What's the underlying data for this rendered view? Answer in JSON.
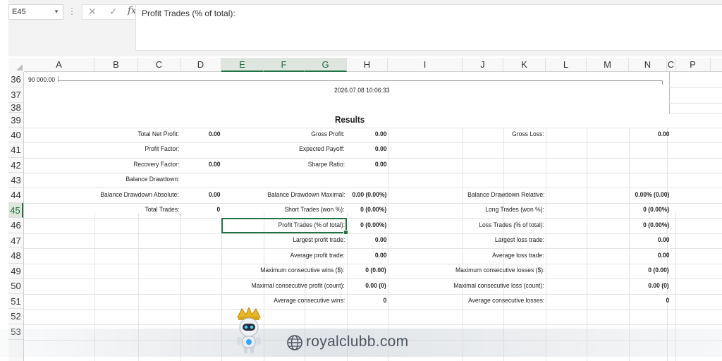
{
  "formula_bar": {
    "name_box": "E45",
    "formula": "Profit Trades (% of total):"
  },
  "columns": [
    "A",
    "B",
    "C",
    "D",
    "E",
    "F",
    "G",
    "H",
    "I",
    "J",
    "K",
    "L",
    "M",
    "N",
    "C",
    "P"
  ],
  "selected_column_letters": [
    "E",
    "F",
    "G"
  ],
  "rows": [
    "36",
    "37",
    "38",
    "39",
    "40",
    "41",
    "42",
    "43",
    "44",
    "45",
    "46",
    "47",
    "48",
    "49",
    "50",
    "51",
    "52",
    "53"
  ],
  "selected_row": "45",
  "chart": {
    "axis_label": "90 000.00"
  },
  "report": {
    "timestamp": "2026.07.08 10:06:33",
    "heading": "Results",
    "left": [
      {
        "label": "Total Net Profit:",
        "value": "0.00"
      },
      {
        "label": "Profit Factor:",
        "value": ""
      },
      {
        "label": "Recovery Factor:",
        "value": "0.00"
      },
      {
        "label": "Balance Drawdown:",
        "value": ""
      },
      {
        "label": "Balance Drawdown Absolute:",
        "value": "0.00"
      },
      {
        "label": "Total Trades:",
        "value": "0"
      }
    ],
    "middle": [
      {
        "label": "Gross Profit:",
        "value": "0.00"
      },
      {
        "label": "Expected Payoff:",
        "value": "0.00"
      },
      {
        "label": "Sharpe Ratio:",
        "value": "0.00"
      },
      {
        "label": "",
        "value": ""
      },
      {
        "label": "Balance Drawdown Maximal:",
        "value": "0.00 (0.00%)"
      },
      {
        "label": "Short Trades (won %):",
        "value": "0 (0.00%)"
      },
      {
        "label": "Profit Trades (% of total):",
        "value": "0 (0.00%)"
      },
      {
        "label": "Largest profit trade:",
        "value": "0.00"
      },
      {
        "label": "Average profit trade:",
        "value": "0.00"
      },
      {
        "label": "Maximum consecutive wins ($):",
        "value": "0 (0.00)"
      },
      {
        "label": "Maximal consecutive profit (count):",
        "value": "0.00 (0)"
      },
      {
        "label": "Average consecutive wins:",
        "value": "0"
      }
    ],
    "right": [
      {
        "label": "Gross Loss:",
        "value": "0.00"
      },
      {
        "label": "",
        "value": ""
      },
      {
        "label": "",
        "value": ""
      },
      {
        "label": "",
        "value": ""
      },
      {
        "label": "Balance Drawdown Relative:",
        "value": "0.00% (0.00)"
      },
      {
        "label": "Long Trades (won %):",
        "value": "0 (0.00%)"
      },
      {
        "label": "Loss Trades (% of total):",
        "value": "0 (0.00%)"
      },
      {
        "label": "Largest loss trade:",
        "value": "0.00"
      },
      {
        "label": "Average loss trade:",
        "value": "0.00"
      },
      {
        "label": "Maximum consecutive losses ($):",
        "value": "0 (0.00)"
      },
      {
        "label": "Maximal consecutive loss (count):",
        "value": "0.00 (0)"
      },
      {
        "label": "Average consecutive losses:",
        "value": "0"
      }
    ]
  },
  "watermark": {
    "text": "royalclubb.com"
  },
  "colors": {
    "selection": "#217346",
    "header_bg": "#f8f8f8",
    "grid": "#e4e4e4"
  },
  "icons": [
    "cancel-icon",
    "enter-icon",
    "function-icon",
    "globe-icon",
    "chevron-down-icon"
  ]
}
